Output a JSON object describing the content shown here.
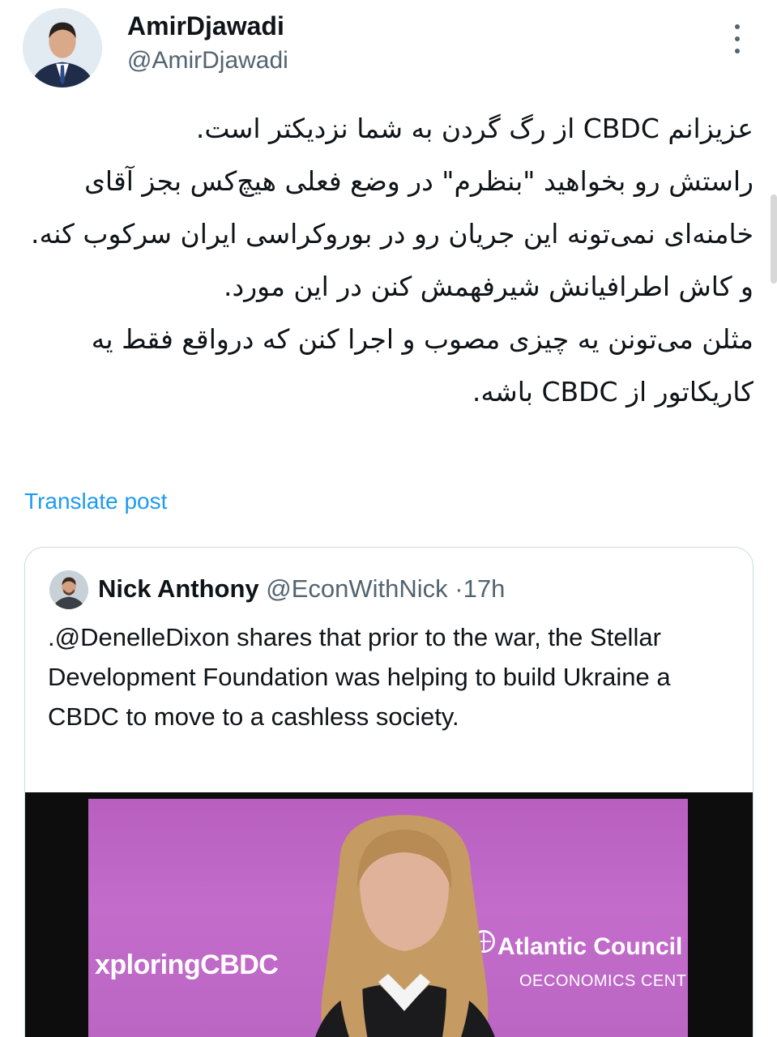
{
  "author": {
    "display_name": "AmirDjawadi",
    "handle": "@AmirDjawadi",
    "avatar_icon": "profile-photo",
    "more_icon": "more-vertical-icon"
  },
  "tweet": {
    "lines": [
      "عزیزانم CBDC از رگ گردن به شما نزدیکتر است.",
      "راستش رو بخواهید \"بنظرم\" در وضع فعلی هیچ‌کس بجز آقای خامنه‌ای نمی‌تونه این جریان رو در بوروکراسی ایران سرکوب کنه. و کاش اطرافیانش شیرفهمش کنن در این مورد.",
      "مثلن می‌تونن یه چیزی مصوب و اجرا کنن که درواقع فقط یه کاریکاتور از CBDC باشه."
    ],
    "translate_label": "Translate post"
  },
  "quote": {
    "name": "Nick Anthony",
    "handle": "@EconWithNick",
    "separator": "·",
    "time": "17h",
    "text": ".@DenelleDixon shares that prior to the war, the Stellar Development Foundation was helping to build Ukraine a CBDC to move to a cashless society.",
    "media": {
      "left_text": "xploringCBDC",
      "org_name": "Atlantic Council",
      "org_center": "OECONOMICS CENTE",
      "backdrop_color": "#c06ac8"
    }
  },
  "colors": {
    "link": "#1d9bf0",
    "secondary_text": "#536471",
    "border": "#cfd9de"
  }
}
